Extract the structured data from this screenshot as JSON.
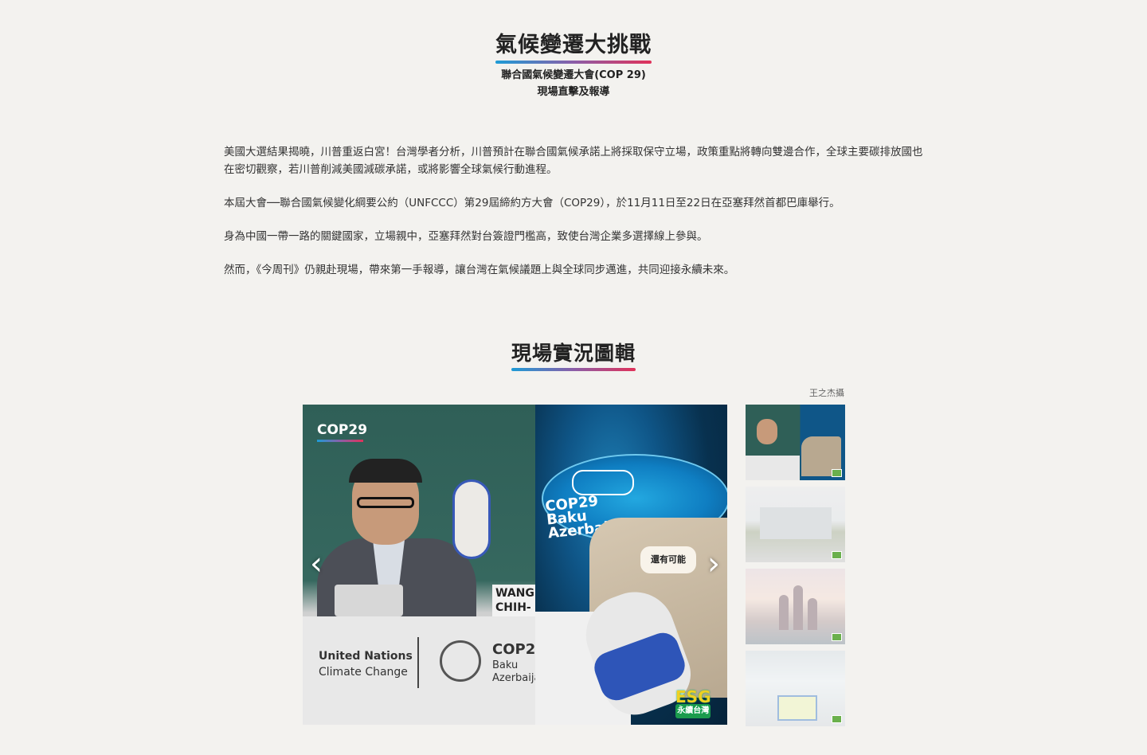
{
  "header": {
    "title": "氣候變遷大挑戰",
    "subtitle_line1": "聯合國氣候變遷大會(COP 29)",
    "subtitle_line2": "現場直擊及報導"
  },
  "article": {
    "paragraphs": [
      "美國大選結果揭曉，川普重返白宮！台灣學者分析，川普預計在聯合國氣候承諾上將採取保守立場，政策重點將轉向雙邊合作，全球主要碳排放國也在密切觀察，若川普削減美國減碳承諾，或將影響全球氣候行動進程。",
      "本屆大會──聯合國氣候變化綱要公約（UNFCCC）第29屆締約方大會（COP29），於11月11日至22日在亞塞拜然首都巴庫舉行。",
      "身為中國一帶一路的關鍵國家，立場親中，亞塞拜然對台簽證門檻高，致使台灣企業多選擇線上參與。",
      "然而，《今周刊》仍親赴現場，帶來第一手報導，讓台灣在氣候議題上與全球同步邁進，共同迎接永續未來。"
    ]
  },
  "gallery": {
    "section_title": "現場實況圖輯",
    "photo_credit": "王之杰攝",
    "prev_glyph": "‹",
    "next_glyph": "›",
    "main_photo": {
      "cop_badge": "COP29",
      "nameplate_line1": "WANG",
      "nameplate_line2": "CHIH-CH",
      "un_line1": "United Nations",
      "un_line2": "Climate Change",
      "cop_logo_text": "COP2",
      "cop_logo_sub1": "Baku",
      "cop_logo_sub2": "Azerbaija",
      "stage_line1": "COP29",
      "stage_line2": "Baku",
      "stage_line3": "Azerbaijan",
      "bag_patch": "還有可能",
      "esg_text": "ESG",
      "esg_sub": "永續台灣"
    },
    "thumbnail_count": 4
  },
  "colors": {
    "accent_gradient": [
      "#1d9bd6",
      "#8b5ea8",
      "#e0325a"
    ],
    "background": "#f3f2ef"
  }
}
